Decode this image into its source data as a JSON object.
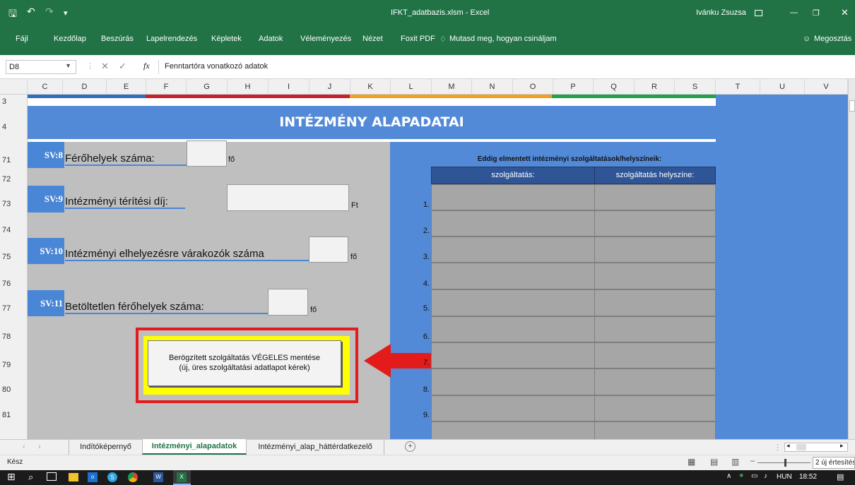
{
  "window": {
    "title": "IFKT_adatbazis.xlsm - Excel",
    "user": "Ivánku Zsuzsa"
  },
  "ribbon": {
    "tabs": [
      "Fájl",
      "Kezdőlap",
      "Beszúrás",
      "Lapelrendezés",
      "Képletek",
      "Adatok",
      "Véleményezés",
      "Nézet",
      "Foxit PDF"
    ],
    "tell_me": "Mutasd meg, hogyan csináljam",
    "share": "Megosztás"
  },
  "formula_bar": {
    "cell_ref": "D8",
    "fx": "fx",
    "content": "Fenntartóra vonatkozó adatok"
  },
  "columns": [
    "C",
    "D",
    "E",
    "F",
    "G",
    "H",
    "I",
    "J",
    "K",
    "L",
    "M",
    "N",
    "O",
    "P",
    "Q",
    "R",
    "S",
    "T",
    "U",
    "V"
  ],
  "rows": [
    "3",
    "4",
    "71",
    "72",
    "73",
    "74",
    "75",
    "76",
    "77",
    "78",
    "79",
    "80",
    "81"
  ],
  "sheet": {
    "title": "INTÉZMÉNY ALAPADATAI",
    "fields": [
      {
        "code": "SV:8",
        "label": "Férőhelyek száma:",
        "unit": "fő"
      },
      {
        "code": "SV:9",
        "label": "Intézményi térítési díj:",
        "unit": "Ft"
      },
      {
        "code": "SV:10",
        "label": "Intézményi elhelyezésre várakozók száma",
        "unit": "fő"
      },
      {
        "code": "SV:11",
        "label": "Betöltetlen férőhelyek száma:",
        "unit": "fő"
      }
    ],
    "save_button": {
      "line1": "Berögzített szolgáltatás VÉGELES mentése",
      "line2": "(új, üres szolgáltatási adatlapot kérek)"
    },
    "table": {
      "caption": "Eddig elmentett intézményi szolgáltatások/helyszíneik:",
      "headers": [
        "szolgáltatás:",
        "szolgáltatás helyszíne:"
      ],
      "row_numbers": [
        "1.",
        "2.",
        "3.",
        "4.",
        "5.",
        "6.",
        "7.",
        "8.",
        "9."
      ]
    }
  },
  "sheet_tabs": [
    "Indítóképernyő",
    "Intézményi_alapadatok",
    "Intézményi_alap_háttérdatkezelő"
  ],
  "active_tab": "Intézményi_alapadatok",
  "status": {
    "ready": "Kész",
    "notifications": "2 új értesítés"
  },
  "taskbar": {
    "language": "HUN",
    "time": "18:52"
  },
  "colors": {
    "excel_green": "#217346",
    "sheet_blue": "#4a86d6",
    "field_gray": "#bfbfbf",
    "button_yellow": "#ffff00",
    "highlight_red": "#e31b1b"
  }
}
